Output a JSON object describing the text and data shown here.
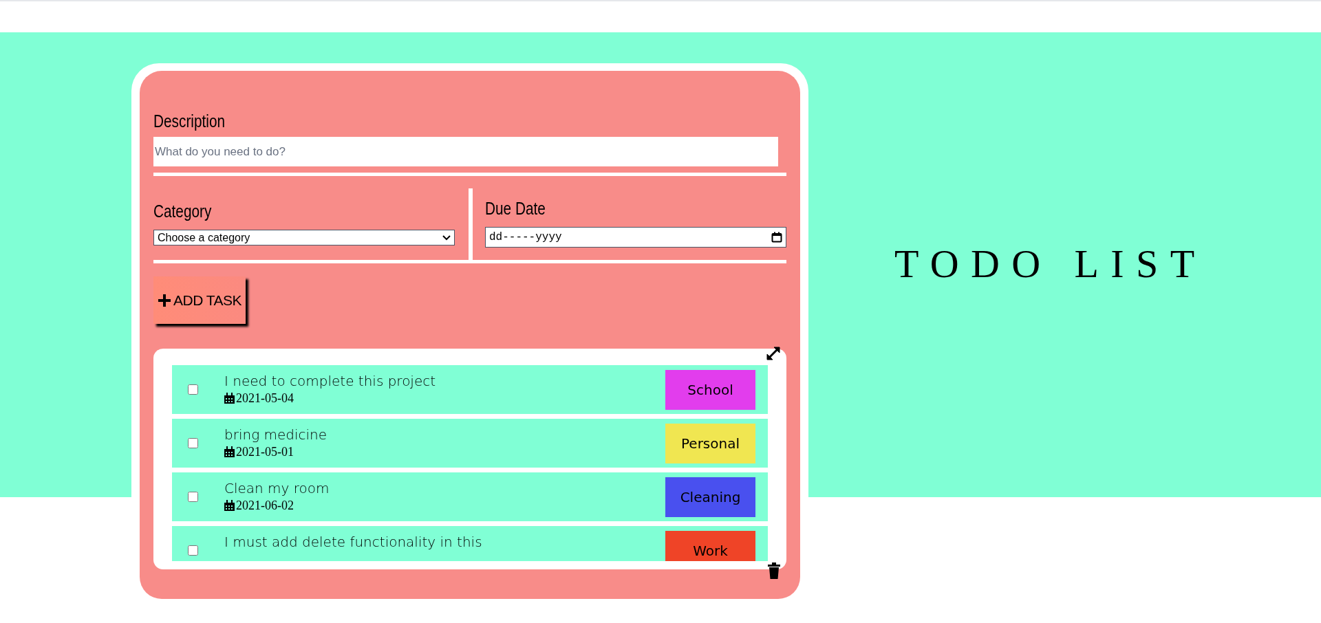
{
  "header": {
    "title": "TODO LIST"
  },
  "form": {
    "description": {
      "label": "Description",
      "placeholder": "What do you need to do?"
    },
    "category": {
      "label": "Category",
      "value": "Choose a category"
    },
    "due_date": {
      "label": "Due Date",
      "placeholder": "dd-----yyyy"
    },
    "add_button": {
      "label": "ADD TASK"
    }
  },
  "tasks": [
    {
      "text": "I need to complete this project",
      "date": "2021-05-04",
      "category": "School",
      "color": "#e23ded",
      "checked": false
    },
    {
      "text": "bring medicine",
      "date": "2021-05-01",
      "category": "Personal",
      "color": "#f0e651",
      "checked": false
    },
    {
      "text": "Clean my room",
      "date": "2021-06-02",
      "category": "Cleaning",
      "color": "#4950ef",
      "checked": false
    },
    {
      "text": "I must add delete functionality in this",
      "category": "Work",
      "color": "#ef4427",
      "checked": false
    }
  ]
}
